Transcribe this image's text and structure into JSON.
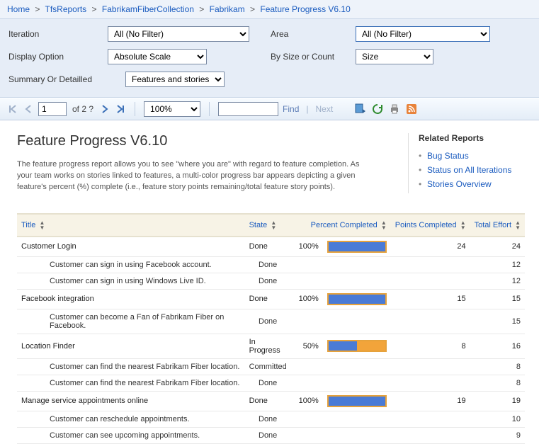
{
  "breadcrumb": {
    "items": [
      "Home",
      "TfsReports",
      "FabrikamFiberCollection",
      "Fabrikam"
    ],
    "current": "Feature Progress V6.10"
  },
  "params": {
    "iteration_label": "Iteration",
    "iteration_value": "All (No Filter)",
    "area_label": "Area",
    "area_value": "All (No Filter)",
    "display_option_label": "Display Option",
    "display_option_value": "Absolute Scale",
    "by_label": "By Size or Count",
    "by_value": "Size",
    "summary_label": "Summary Or Detailled",
    "summary_value": "Features and stories"
  },
  "toolbar": {
    "page": "1",
    "of_text": "of 2 ?",
    "zoom": "100%",
    "find_label": "Find",
    "next_label": "Next",
    "find_value": ""
  },
  "report": {
    "title": "Feature Progress V6.10",
    "description": "The feature progress report allows you to see \"where you are\" with regard to feature completion. As your team works on stories linked to features, a multi-color progress bar appears depicting a given feature's percent (%) complete (i.e., feature story points remaining/total feature story points).",
    "related_heading": "Related Reports",
    "related": [
      {
        "label": "Bug Status"
      },
      {
        "label": "Status on All Iterations"
      },
      {
        "label": "Stories Overview"
      }
    ]
  },
  "columns": {
    "title": "Title",
    "state": "State",
    "percent": "Percent Completed",
    "points": "Points Completed",
    "effort": "Total Effort"
  },
  "chart_data": {
    "type": "table",
    "title": "Feature Progress V6.10",
    "columns": [
      "Title",
      "State",
      "Percent Completed",
      "Points Completed",
      "Total Effort"
    ],
    "rows": [
      {
        "level": 0,
        "title": "Customer Login",
        "state": "Done",
        "percent": 100,
        "points": 24,
        "effort": 24
      },
      {
        "level": 1,
        "title": "Customer can sign in using Facebook account.",
        "state": "Done",
        "percent": null,
        "points": null,
        "effort": 12
      },
      {
        "level": 1,
        "title": "Customer can sign in using Windows Live ID.",
        "state": "Done",
        "percent": null,
        "points": null,
        "effort": 12
      },
      {
        "level": 0,
        "title": "Facebook integration",
        "state": "Done",
        "percent": 100,
        "points": 15,
        "effort": 15
      },
      {
        "level": 1,
        "title": "Customer can become a Fan of Fabrikam Fiber on Facebook.",
        "state": "Done",
        "percent": null,
        "points": null,
        "effort": 15
      },
      {
        "level": 0,
        "title": "Location Finder",
        "state": "In Progress",
        "percent": 50,
        "points": 8,
        "effort": 16
      },
      {
        "level": 1,
        "title": "Customer can find the nearest Fabrikam Fiber location.",
        "state": "Committed",
        "percent": null,
        "points": null,
        "effort": 8
      },
      {
        "level": 1,
        "title": "Customer can find the nearest Fabrikam Fiber location.",
        "state": "Done",
        "percent": null,
        "points": null,
        "effort": 8
      },
      {
        "level": 0,
        "title": "Manage service appointments online",
        "state": "Done",
        "percent": 100,
        "points": 19,
        "effort": 19
      },
      {
        "level": 1,
        "title": "Customer can reschedule appointments.",
        "state": "Done",
        "percent": null,
        "points": null,
        "effort": 10
      },
      {
        "level": 1,
        "title": "Customer can see upcoming appointments.",
        "state": "Done",
        "percent": null,
        "points": null,
        "effort": 9
      }
    ]
  }
}
